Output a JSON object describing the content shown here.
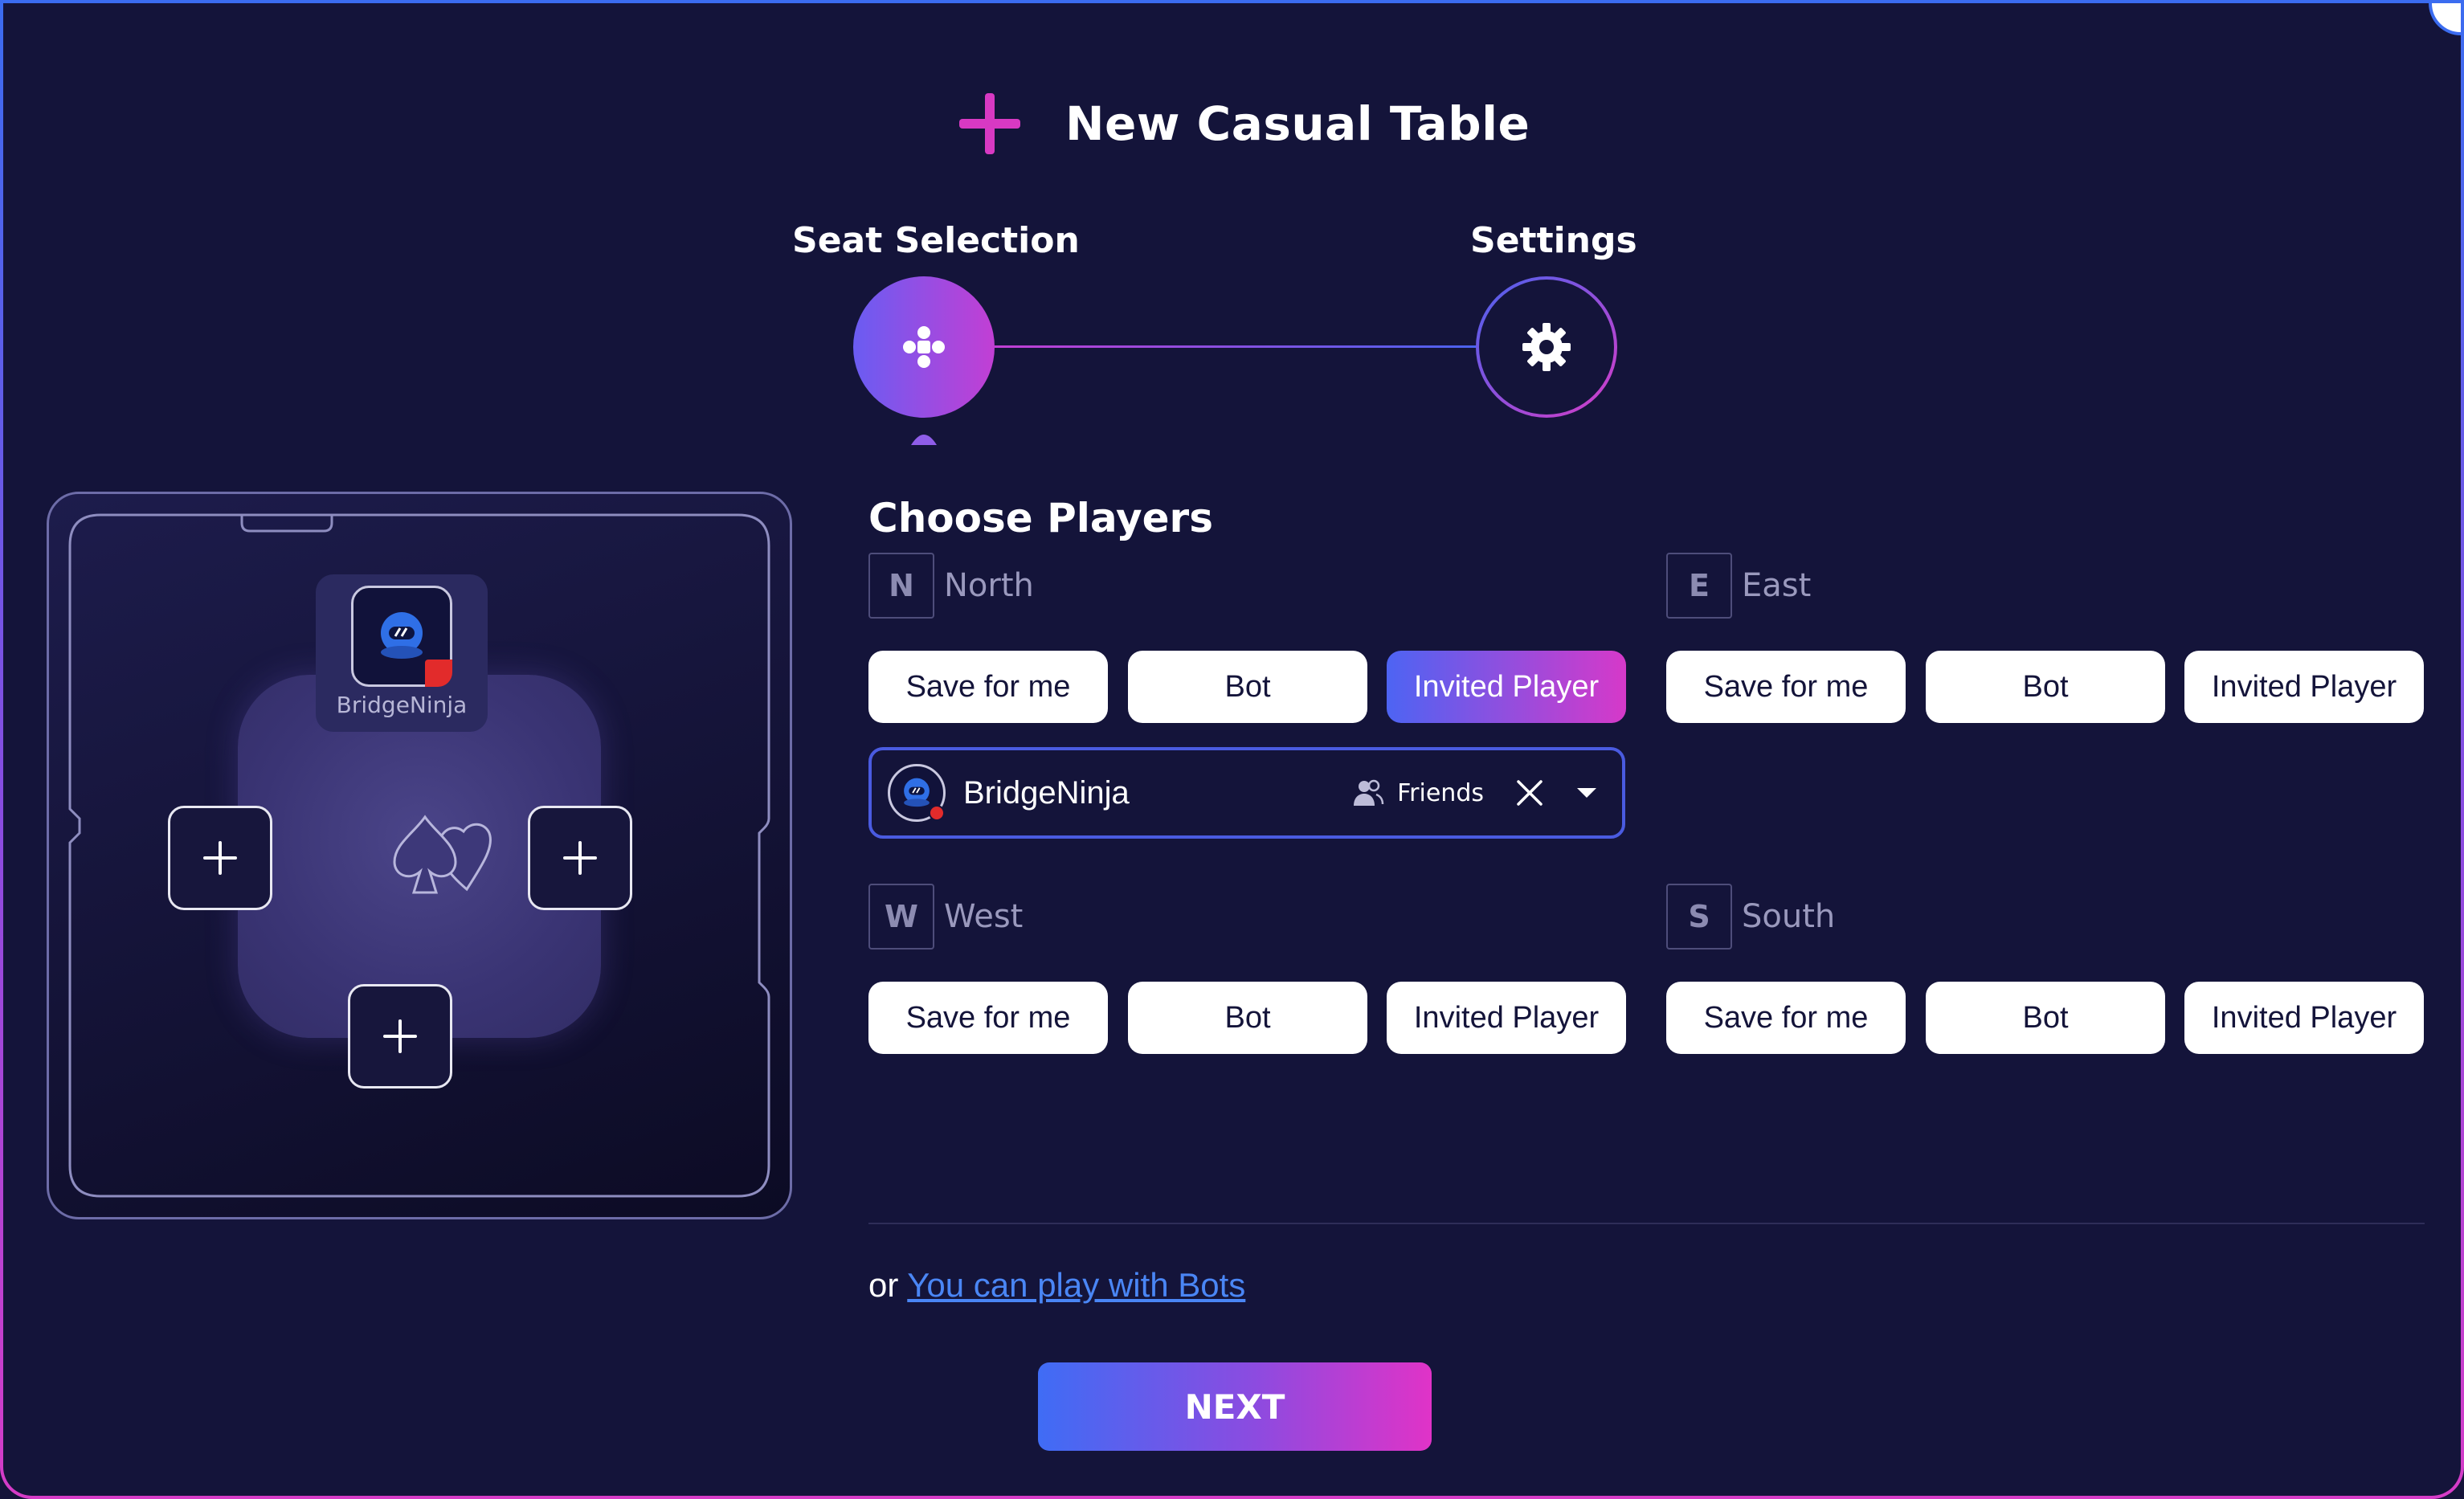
{
  "header": {
    "title": "New Casual Table"
  },
  "stepper": {
    "steps": [
      {
        "label": "Seat Selection",
        "state": "active",
        "icon": "seats-icon"
      },
      {
        "label": "Settings",
        "state": "inactive",
        "icon": "gear-icon"
      }
    ]
  },
  "preview": {
    "north_player": "BridgeNinja"
  },
  "choose_players": {
    "title": "Choose Players",
    "options": [
      "Save for me",
      "Bot",
      "Invited Player"
    ],
    "seats": {
      "north": {
        "letter": "N",
        "name": "North",
        "selected": "Invited Player"
      },
      "east": {
        "letter": "E",
        "name": "East",
        "selected": ""
      },
      "west": {
        "letter": "W",
        "name": "West",
        "selected": ""
      },
      "south": {
        "letter": "S",
        "name": "South",
        "selected": ""
      }
    },
    "invite": {
      "player": "BridgeNinja",
      "group": "Friends"
    }
  },
  "footer": {
    "or_text": "or ",
    "bots_link": "You can play with Bots",
    "next_label": "NEXT"
  },
  "colors": {
    "accent_pink": "#d839c3",
    "accent_blue": "#4d64f3",
    "background": "#14143a"
  }
}
